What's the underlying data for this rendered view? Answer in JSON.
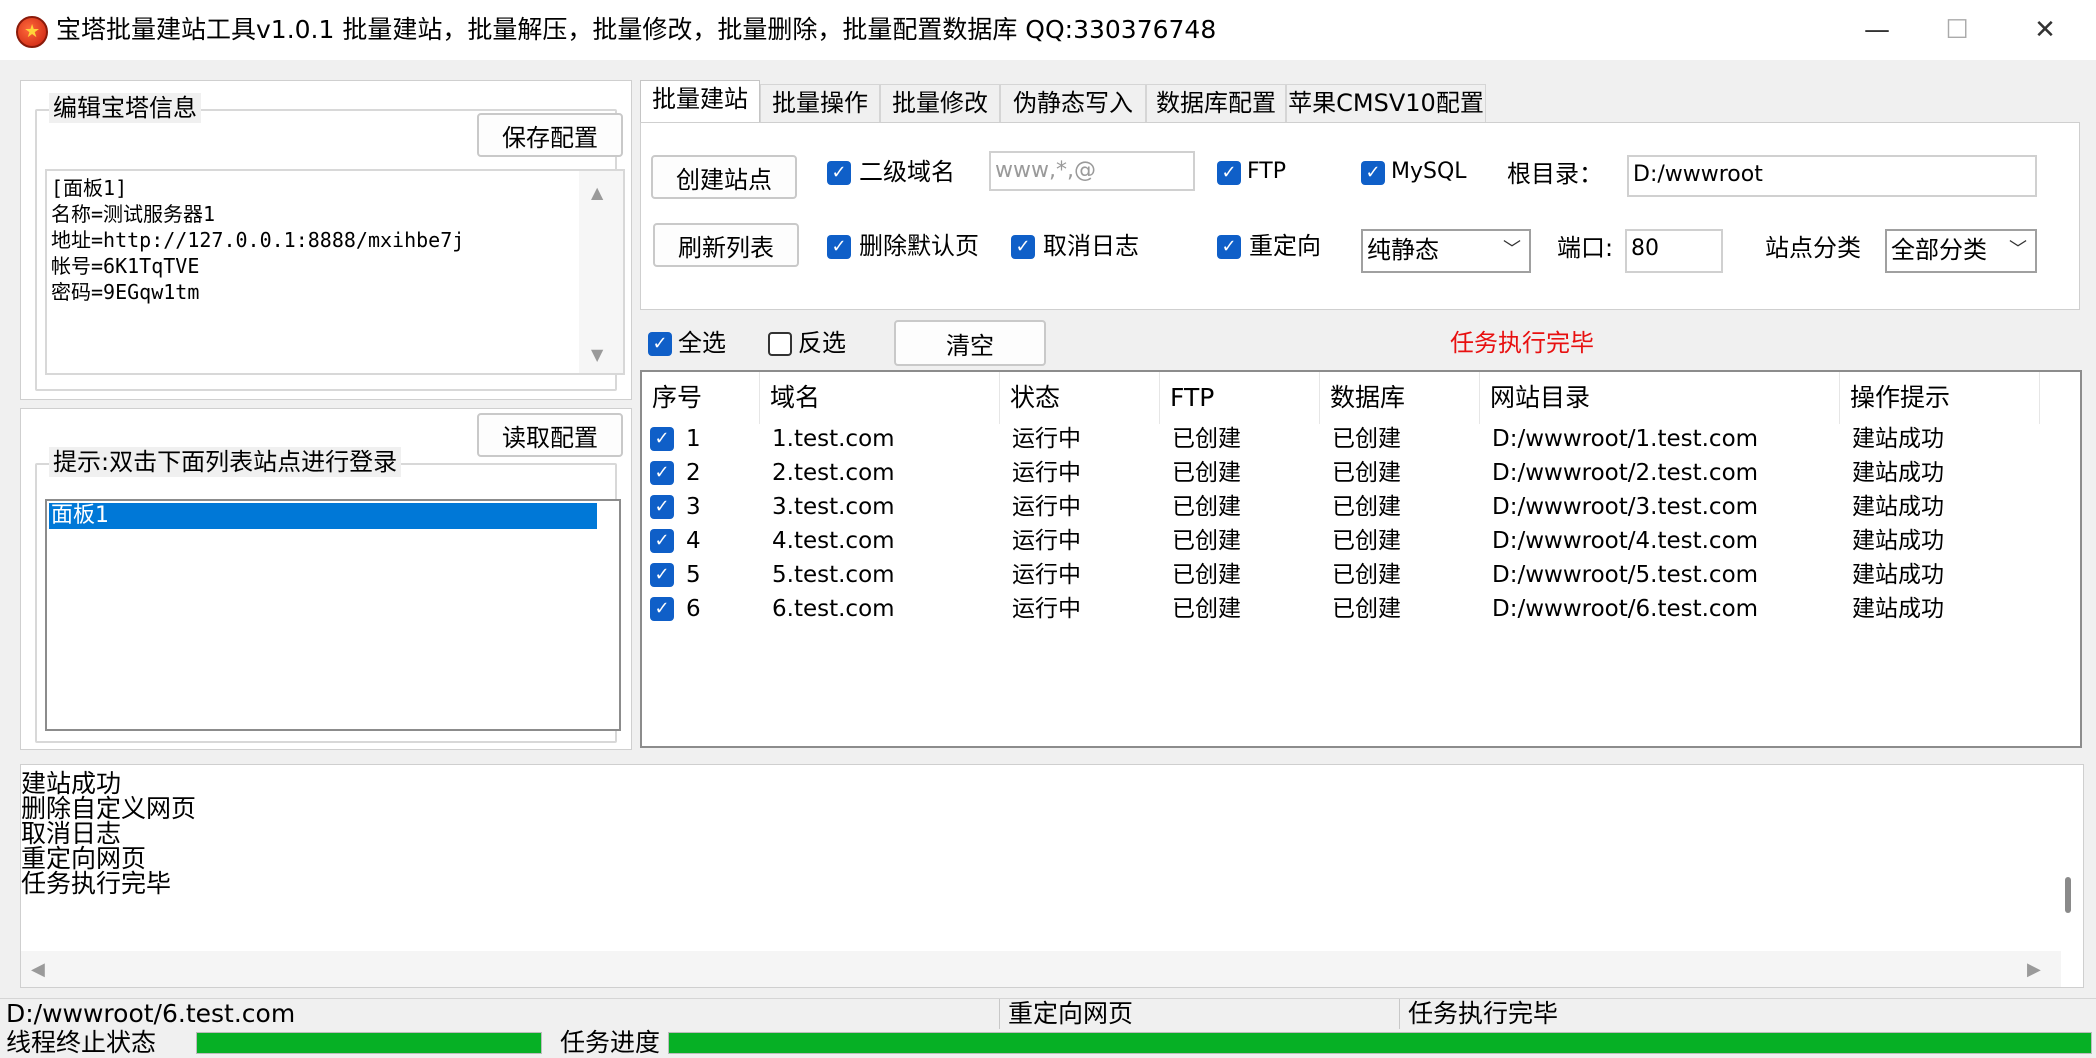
{
  "window": {
    "title": "宝塔批量建站工具v1.0.1 批量建站，批量解压，批量修改，批量删除，批量配置数据库 QQ:330376748",
    "minimize": "—",
    "maximize": "☐",
    "close": "✕",
    "app_icon": "flame-star-icon"
  },
  "left_panel": {
    "edit_group_label": "编辑宝塔信息",
    "save_button": "保存配置",
    "config_lines": [
      "[面板1]",
      "名称=测试服务器1",
      "地址=http://127.0.0.1:8888/mxihbe7j",
      "帐号=6K1TqTVE",
      "密码=9EGqw1tm"
    ],
    "load_button": "读取配置",
    "hint_label": "提示:双击下面列表站点进行登录",
    "site_list": [
      "面板1"
    ]
  },
  "tabs": [
    "批量建站",
    "批量操作",
    "批量修改",
    "伪静态写入",
    "数据库配置",
    "苹果CMSV10配置"
  ],
  "active_tab": "批量建站",
  "build_panel": {
    "create_button": "创建站点",
    "refresh_button": "刷新列表",
    "subdomain": {
      "label": "二级域名",
      "checked": true,
      "input_value": "www,*,@"
    },
    "ftp": {
      "label": "FTP",
      "checked": true
    },
    "mysql": {
      "label": "MySQL",
      "checked": true
    },
    "root_label": "根目录：",
    "root_value": "D:/wwwroot",
    "delete_default": {
      "label": "删除默认页",
      "checked": true
    },
    "cancel_log": {
      "label": "取消日志",
      "checked": true
    },
    "redirect": {
      "label": "重定向",
      "checked": true
    },
    "php_select": "纯静态",
    "port_label": "端口:",
    "port_value": "80",
    "category_label": "站点分类",
    "category_select": "全部分类"
  },
  "list_controls": {
    "select_all": {
      "label": "全选",
      "checked": true
    },
    "invert": {
      "label": "反选",
      "checked": false
    },
    "clear_button": "清空",
    "status_text": "任务执行完毕",
    "status_color": "#e81010"
  },
  "table": {
    "columns": [
      "序号",
      "域名",
      "状态",
      "FTP",
      "数据库",
      "网站目录",
      "操作提示"
    ],
    "rows": [
      {
        "checked": true,
        "cells": [
          "1",
          "1.test.com",
          "运行中",
          "已创建",
          "已创建",
          "D:/wwwroot/1.test.com",
          "建站成功"
        ]
      },
      {
        "checked": true,
        "cells": [
          "2",
          "2.test.com",
          "运行中",
          "已创建",
          "已创建",
          "D:/wwwroot/2.test.com",
          "建站成功"
        ]
      },
      {
        "checked": true,
        "cells": [
          "3",
          "3.test.com",
          "运行中",
          "已创建",
          "已创建",
          "D:/wwwroot/3.test.com",
          "建站成功"
        ]
      },
      {
        "checked": true,
        "cells": [
          "4",
          "4.test.com",
          "运行中",
          "已创建",
          "已创建",
          "D:/wwwroot/4.test.com",
          "建站成功"
        ]
      },
      {
        "checked": true,
        "cells": [
          "5",
          "5.test.com",
          "运行中",
          "已创建",
          "已创建",
          "D:/wwwroot/5.test.com",
          "建站成功"
        ]
      },
      {
        "checked": true,
        "cells": [
          "6",
          "6.test.com",
          "运行中",
          "已创建",
          "已创建",
          "D:/wwwroot/6.test.com",
          "建站成功"
        ]
      }
    ]
  },
  "log": [
    "建站成功",
    "删除自定义网页",
    "取消日志",
    "重定向网页",
    "任务执行完毕"
  ],
  "status_bar": {
    "path": "D:/wwwroot/6.test.com",
    "action": "重定向网页",
    "message": "任务执行完毕",
    "thread_label": "线程终止状态",
    "progress_label": "任务进度",
    "thread_progress": 1.0,
    "task_progress": 1.0,
    "progress_color": "#06b025"
  }
}
